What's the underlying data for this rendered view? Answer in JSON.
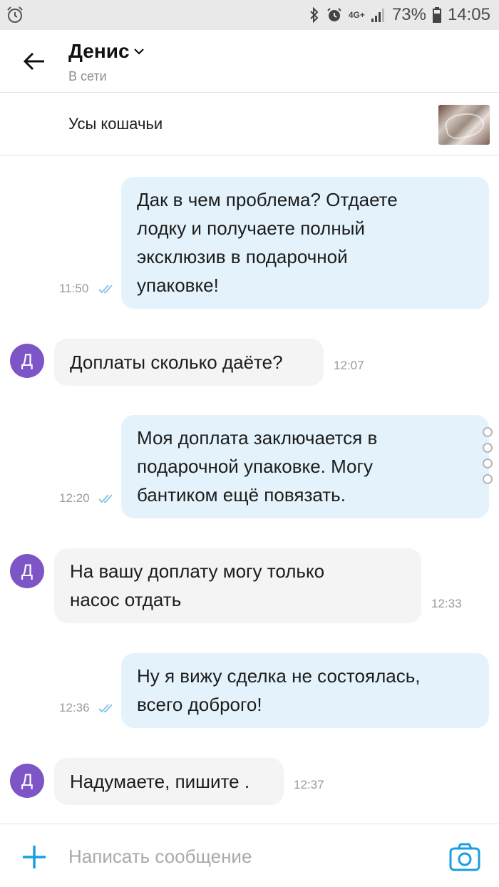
{
  "status_bar": {
    "network": "4G+",
    "battery": "73%",
    "time": "14:05",
    "icons": [
      "alarm-icon",
      "bluetooth-icon",
      "alarm-clock-icon",
      "signal-icon",
      "battery-icon"
    ]
  },
  "header": {
    "name": "Денис",
    "status": "В сети"
  },
  "item": {
    "title": "Усы кошачьи"
  },
  "messages": [
    {
      "direction": "out",
      "lines": [
        "Дак в чем проблема? Отдаете",
        "лодку и получаете полный",
        "эксклюзив в подарочной",
        "упаковке!"
      ],
      "time": "11:50",
      "read": true
    },
    {
      "direction": "in",
      "avatar": "Д",
      "lines": [
        "Доплаты сколько даёте?"
      ],
      "time": "12:07"
    },
    {
      "direction": "out",
      "lines": [
        "Моя доплата заключается в",
        "подарочной упаковке. Могу",
        "бантиком ещё повязать."
      ],
      "time": "12:20",
      "read": true
    },
    {
      "direction": "in",
      "avatar": "Д",
      "lines": [
        "На вашу доплату могу только",
        "насос отдать"
      ],
      "time": "12:33"
    },
    {
      "direction": "out",
      "lines": [
        "Ну я вижу сделка не состоялась,",
        "всего доброго!"
      ],
      "time": "12:36",
      "read": true
    },
    {
      "direction": "in",
      "avatar": "Д",
      "lines": [
        "Надумаете, пишите ."
      ],
      "time": "12:37"
    }
  ],
  "composer": {
    "placeholder": "Написать сообщение"
  },
  "colors": {
    "accent": "#1a9ee0",
    "outgoing_bubble": "#e4f3fb",
    "incoming_bubble": "#f4f4f4",
    "avatar": "#7d55c7",
    "read_ticks": "#8cc6ea"
  }
}
